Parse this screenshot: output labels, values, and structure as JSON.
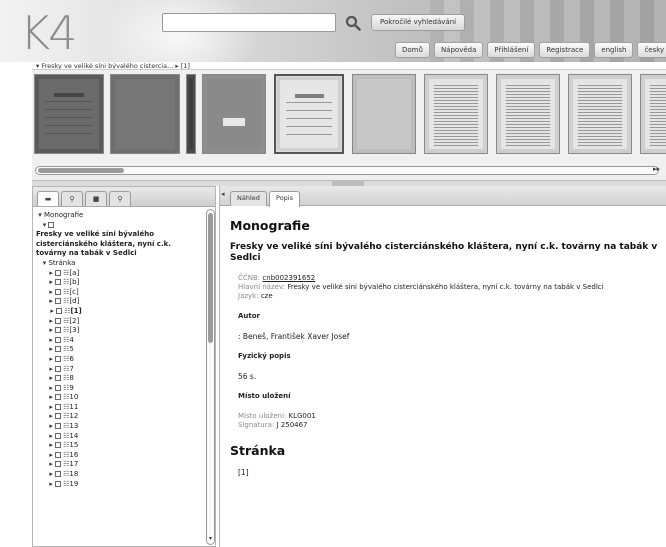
{
  "header": {
    "logo": "K4",
    "search_placeholder": "",
    "advanced_search": "Pokročilé vyhledávání",
    "nav": [
      "Domů",
      "Nápověda",
      "Přihlášení",
      "Registrace",
      "english",
      "česky"
    ]
  },
  "breadcrumb": {
    "document": "Fresky ve veliké síni bývalého cistercia...",
    "page": "[1]"
  },
  "thumbnails": [
    {
      "kind": "title-dark",
      "selected": false
    },
    {
      "kind": "blank-dark",
      "selected": false
    },
    {
      "kind": "spine",
      "selected": false
    },
    {
      "kind": "cover-label",
      "selected": false
    },
    {
      "kind": "title-light",
      "selected": true
    },
    {
      "kind": "blank-light",
      "selected": false
    },
    {
      "kind": "text",
      "selected": false
    },
    {
      "kind": "text",
      "selected": false
    },
    {
      "kind": "text",
      "selected": false
    },
    {
      "kind": "text",
      "selected": false
    },
    {
      "kind": "text",
      "selected": false
    }
  ],
  "left_tabs": [
    "tree-tab",
    "search-tab",
    "list-tab",
    "info-tab"
  ],
  "tree": {
    "root_label": "Monografie",
    "title": "Fresky ve veliké síni bývalého cisterciánského kláštera, nyní c.k. továrny na tabák v Sedlci",
    "pages_group": "Stránka",
    "pages": [
      "[a]",
      "[b]",
      "[c]",
      "[d]",
      "[1]",
      "[2]",
      "[3]",
      "4",
      "5",
      "6",
      "7",
      "8",
      "9",
      "10",
      "11",
      "12",
      "13",
      "14",
      "15",
      "16",
      "17",
      "18",
      "19"
    ],
    "selected_page": "[1]"
  },
  "main_tabs": {
    "preview": "Náhled",
    "description": "Popis"
  },
  "detail": {
    "section_title": "Monografie",
    "doc_title": "Fresky ve veliké síni bývalého cisterciánského kláštera, nyní c.k. továrny na tabák v Sedlci",
    "ccnb_label": "ČČNB:",
    "ccnb_value": "cnb002391652",
    "main_title_label": "Hlavní název:",
    "main_title_value": "Fresky ve veliké síni bývalého cisterciánského kláštera, nyní c.k. továrny na tabák v Sedlci",
    "language_label": "Jazyk:",
    "language_value": "cze",
    "author_heading": "Autor",
    "author_value": ": Beneš, František Xaver Josef",
    "physical_heading": "Fyzický popis",
    "physical_value": "56 s.",
    "location_heading": "Místo uložení",
    "location_label": "Místo uložení:",
    "location_value": "KLG001",
    "signature_label": "Signatura:",
    "signature_value": "J 250467",
    "page_section_title": "Stránka",
    "page_value": "[1]"
  }
}
